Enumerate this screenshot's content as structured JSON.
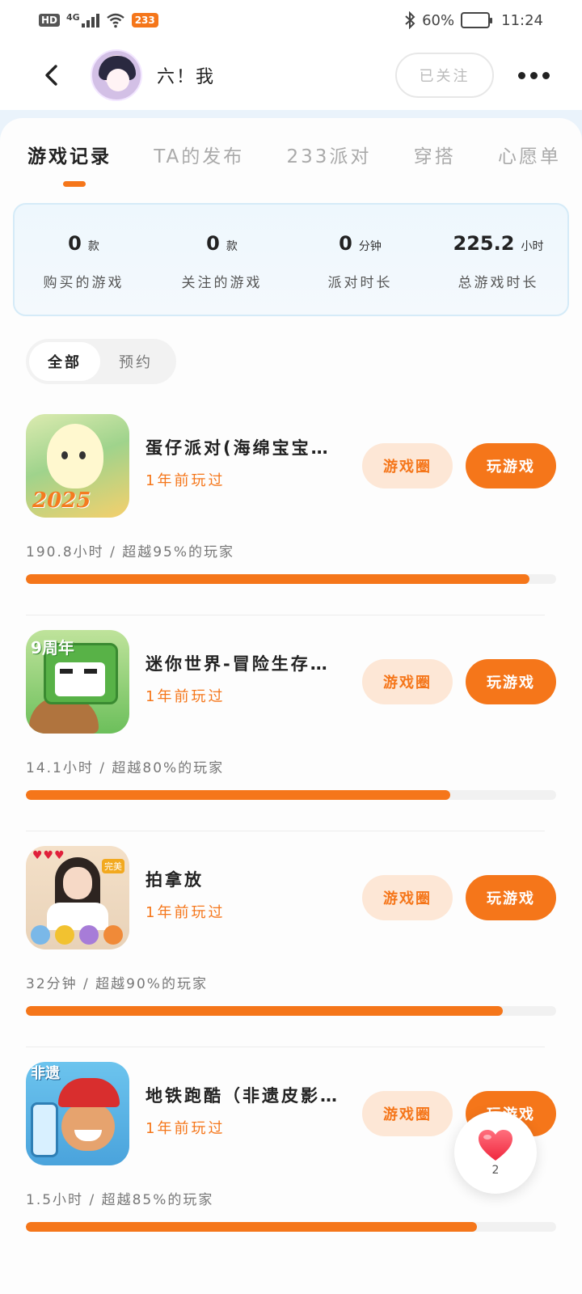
{
  "status_bar": {
    "hd": "HD",
    "network": "4G",
    "app_badge": "233",
    "battery_text": "60%",
    "battery_level": 0.6,
    "time": "11:24"
  },
  "header": {
    "username": "六！我",
    "follow_label": "已关注"
  },
  "tabs": [
    {
      "label": "游戏记录",
      "active": true
    },
    {
      "label": "TA的发布",
      "active": false
    },
    {
      "label": "233派对",
      "active": false
    },
    {
      "label": "穿搭",
      "active": false
    },
    {
      "label": "心愿单",
      "active": false
    }
  ],
  "stats": [
    {
      "value": "0",
      "unit": "款",
      "label": "购买的游戏"
    },
    {
      "value": "0",
      "unit": "款",
      "label": "关注的游戏"
    },
    {
      "value": "0",
      "unit": "分钟",
      "label": "派对时长"
    },
    {
      "value": "225.2",
      "unit": "小时",
      "label": "总游戏时长"
    }
  ],
  "filter": {
    "all": "全部",
    "reserve": "预约"
  },
  "buttons": {
    "circle": "游戏圈",
    "play": "玩游戏"
  },
  "games": [
    {
      "name": "蛋仔派对(海绵宝宝…",
      "last_played": "1年前玩过",
      "stats": "190.8小时 / 超越95%的玩家",
      "progress": 0.95,
      "icon": "eggy-party-icon",
      "icon_text": "2025"
    },
    {
      "name": "迷你世界-冒险生存…",
      "last_played": "1年前玩过",
      "stats": "14.1小时 / 超越80%的玩家",
      "progress": 0.8,
      "icon": "mini-world-icon",
      "icon_text": "9周年"
    },
    {
      "name": "拍拿放",
      "last_played": "1年前玩过",
      "stats": "32分钟 / 超越90%的玩家",
      "progress": 0.9,
      "icon": "pai-na-fang-icon",
      "icon_text": "完美"
    },
    {
      "name": "地铁跑酷（非遗皮影…",
      "last_played": "1年前玩过",
      "stats": "1.5小时 / 超越85%的玩家",
      "progress": 0.85,
      "icon": "subway-surfers-icon",
      "icon_text": "非遗"
    }
  ],
  "float_like": {
    "count": "2"
  },
  "colors": {
    "accent": "#f5761a",
    "accent_light": "#fde7d6",
    "stats_border": "#d5ebf8"
  }
}
